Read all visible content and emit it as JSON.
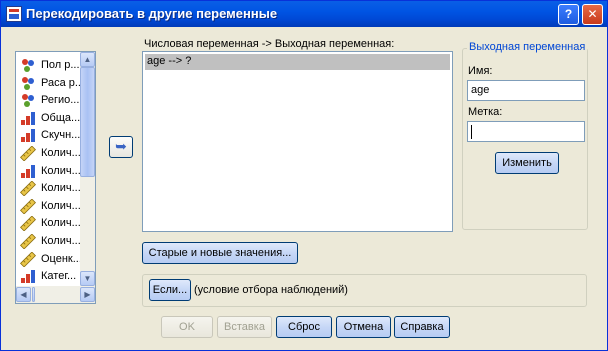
{
  "window": {
    "title": "Перекодировать в другие переменные",
    "help_glyph": "?",
    "close_glyph": "✕"
  },
  "variables": [
    {
      "label": "Пол р...",
      "icon": "nominal-icon"
    },
    {
      "label": "Раса р...",
      "icon": "nominal-icon"
    },
    {
      "label": "Регио...",
      "icon": "nominal-icon"
    },
    {
      "label": "Обща...",
      "icon": "ordinal-icon"
    },
    {
      "label": "Скучн...",
      "icon": "ordinal-icon"
    },
    {
      "label": "Колич...",
      "icon": "scale-icon"
    },
    {
      "label": "Колич...",
      "icon": "ordinal-icon"
    },
    {
      "label": "Колич...",
      "icon": "scale-icon"
    },
    {
      "label": "Колич...",
      "icon": "scale-icon"
    },
    {
      "label": "Колич...",
      "icon": "scale-icon"
    },
    {
      "label": "Колич...",
      "icon": "scale-icon"
    },
    {
      "label": "Оценк...",
      "icon": "scale-icon"
    },
    {
      "label": "Катег...",
      "icon": "ordinal-icon"
    }
  ],
  "move_button_glyph": "➥",
  "mapping": {
    "header": "Числовая переменная -> Выходная переменная:",
    "rows": [
      "age --> ?"
    ]
  },
  "output": {
    "legend": "Выходная переменная",
    "name_label": "Имя:",
    "name_value": "age",
    "label_label": "Метка:",
    "label_value": "",
    "change_button": "Изменить"
  },
  "old_new_button": "Старые и новые значения...",
  "if_button": "Если...",
  "if_note": "(условие отбора наблюдений)",
  "footer_buttons": {
    "ok": "OK",
    "paste": "Вставка",
    "reset": "Сброс",
    "cancel": "Отмена",
    "help": "Справка"
  },
  "colors": {
    "title_bar": "#0054e3",
    "window_bg": "#ece9d8",
    "accent_text": "#0046d5",
    "selection": "#c0c0c0"
  }
}
